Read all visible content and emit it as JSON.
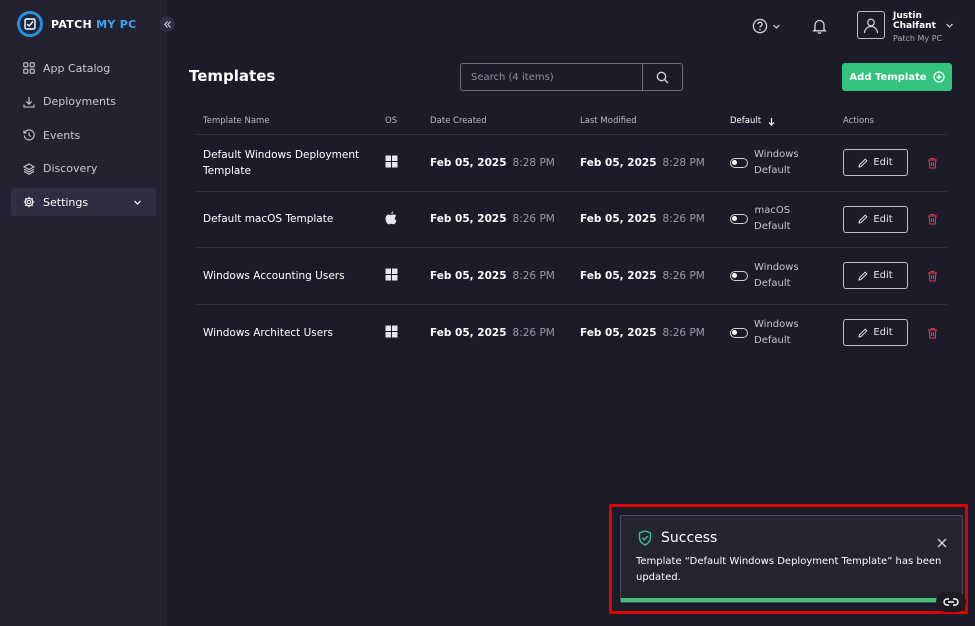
{
  "brand": {
    "name_part1": "PATCH",
    "name_part2": "MY PC",
    "accent": "#34c37f"
  },
  "sidebar": {
    "items": [
      {
        "label": "App Catalog",
        "icon": "grid-icon"
      },
      {
        "label": "Deployments",
        "icon": "download-icon"
      },
      {
        "label": "Events",
        "icon": "history-icon"
      },
      {
        "label": "Discovery",
        "icon": "layers-icon"
      },
      {
        "label": "Settings",
        "icon": "gear-icon",
        "active": true
      }
    ]
  },
  "user": {
    "first_name": "Justin",
    "last_name": "Chalfant",
    "org": "Patch My PC"
  },
  "page": {
    "title": "Templates",
    "search_placeholder": "Search (4 items)",
    "add_button": "Add Template"
  },
  "table": {
    "headers": {
      "name": "Template Name",
      "os": "OS",
      "created": "Date Created",
      "modified": "Last Modified",
      "default": "Default",
      "actions": "Actions"
    },
    "rows": [
      {
        "name": "Default Windows Deployment Template",
        "os": "windows",
        "created_date": "Feb 05, 2025",
        "created_time": "8:28 PM",
        "modified_date": "Feb 05, 2025",
        "modified_time": "8:28 PM",
        "default_os": "Windows",
        "default_word": "Default",
        "edit": "Edit"
      },
      {
        "name": "Default macOS Template",
        "os": "apple",
        "created_date": "Feb 05, 2025",
        "created_time": "8:26 PM",
        "modified_date": "Feb 05, 2025",
        "modified_time": "8:26 PM",
        "default_os": "macOS",
        "default_word": "Default",
        "edit": "Edit"
      },
      {
        "name": "Windows Accounting Users",
        "os": "windows",
        "created_date": "Feb 05, 2025",
        "created_time": "8:26 PM",
        "modified_date": "Feb 05, 2025",
        "modified_time": "8:26 PM",
        "default_os": "Windows",
        "default_word": "Default",
        "edit": "Edit"
      },
      {
        "name": "Windows Architect Users",
        "os": "windows",
        "created_date": "Feb 05, 2025",
        "created_time": "8:26 PM",
        "modified_date": "Feb 05, 2025",
        "modified_time": "8:26 PM",
        "default_os": "Windows",
        "default_word": "Default",
        "edit": "Edit"
      }
    ]
  },
  "toast": {
    "title": "Success",
    "message": "Template “Default Windows Deployment Template” has been updated.",
    "progress": 0.93,
    "color": "#3fbf7a"
  }
}
